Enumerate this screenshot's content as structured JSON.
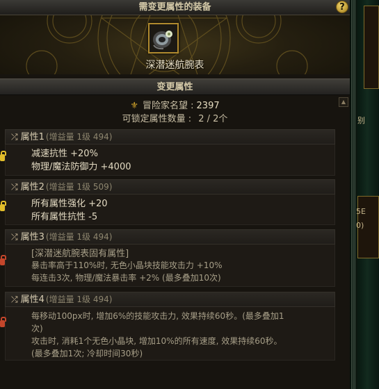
{
  "equip_panel": {
    "title": "需变更属性的装备",
    "help_label": "?",
    "item_name": "深潜迷航腕表"
  },
  "attr_panel": {
    "title": "变更属性",
    "scroll_up": "▲",
    "renown_label": "冒险家名望 :",
    "renown_value": "2397",
    "lock_label": "可锁定属性数量 :",
    "lock_value": "2 / 2个"
  },
  "attributes": [
    {
      "name": "属性1",
      "sub": "(增益量 1级 494)",
      "lock": "gold",
      "lines": [
        "减速抗性 +20%",
        "物理/魔法防御力 +4000"
      ]
    },
    {
      "name": "属性2",
      "sub": "(增益量 1级 509)",
      "lock": "gold",
      "lines": [
        "所有属性强化 +20",
        "所有属性抗性 -5"
      ]
    },
    {
      "name": "属性3",
      "sub": "(增益量 1级 494)",
      "lock": "red",
      "lines": [
        "[深潜迷航腕表固有属性]",
        "暴击率高于110%时, 无色小晶块技能攻击力 +10%",
        "每连击3次, 物理/魔法暴击率 +2% (最多叠加10次)"
      ]
    },
    {
      "name": "属性4",
      "sub": "(增益量 1级 494)",
      "lock": "red",
      "lines": [
        "每移动100px时, 增加6%的技能攻击力, 效果持续60秒。(最多叠加1",
        "次)",
        "攻击时, 消耗1个无色小晶块, 增加10%的所有速度, 效果持续60秒。",
        "(最多叠加1次; 冷却时间30秒)"
      ]
    }
  ],
  "right_strip": {
    "text_a": "别",
    "text_b": "5E",
    "text_c": "0)"
  },
  "colors": {
    "accent_gold": "#e2bd2a",
    "lock_red": "#c4462b",
    "panel_bg": "#17140f"
  }
}
